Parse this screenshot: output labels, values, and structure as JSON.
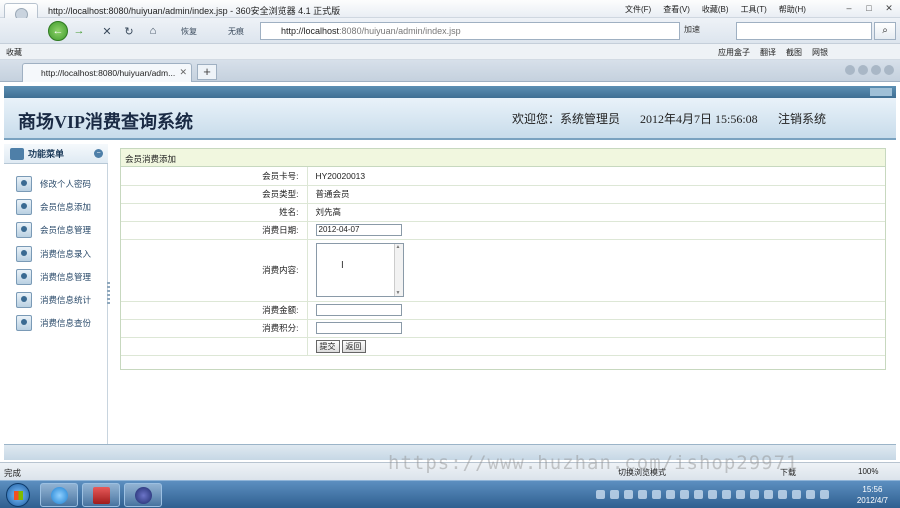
{
  "browser": {
    "window_title": "http://localhost:8080/huiyuan/admin/index.jsp - 360安全浏览器 4.1 正式版",
    "menus": [
      "文件(F)",
      "查看(V)",
      "收藏(B)",
      "工具(T)",
      "帮助(H)"
    ],
    "nav": {
      "restore": "恢复",
      "noimage": "无痕"
    },
    "address_host": "http://localhost",
    "address_path": ":8080/huiyuan/admin/index.jsp",
    "accelerate": "加速",
    "favorites_label": "收藏",
    "toolbar_items": [
      "应用盒子",
      "翻译",
      "截图",
      "网银"
    ],
    "tab_title": "http://localhost:8080/huiyuan/adm..."
  },
  "app": {
    "system_name": "商场VIP消费查询系统",
    "welcome": "欢迎您：系统管理员",
    "datetime": "2012年4月7日 15:56:08",
    "logout": "注销系统",
    "sidebar_title": "功能菜单",
    "menu": [
      "修改个人密码",
      "会员信息添加",
      "会员信息管理",
      "消费信息录入",
      "消费信息管理",
      "消费信息统计",
      "消费信息查份"
    ]
  },
  "form": {
    "title": "会员消费添加",
    "card_label": "会员卡号:",
    "card_value": "HY20020013",
    "type_label": "会员类型:",
    "type_value": "普通会员",
    "name_label": "姓名:",
    "name_value": "刘先高",
    "date_label": "消费日期:",
    "date_value": "2012-04-07",
    "content_label": "消费内容:",
    "amount_label": "消费金额:",
    "points_label": "消费积分:",
    "submit": "提交",
    "back": "返回"
  },
  "statusbar": {
    "left": "完成",
    "mode": "切换浏览模式",
    "download": "下载",
    "zoom": "100%"
  },
  "watermark": "https://www.huzhan.com/ishop29971",
  "taskbar": {
    "time": "15:56",
    "date": "2012/4/7"
  },
  "colors": {
    "header_bg": "#c8dceb",
    "accent": "#3f6f93",
    "form_title_bg": "#f1f7df"
  }
}
